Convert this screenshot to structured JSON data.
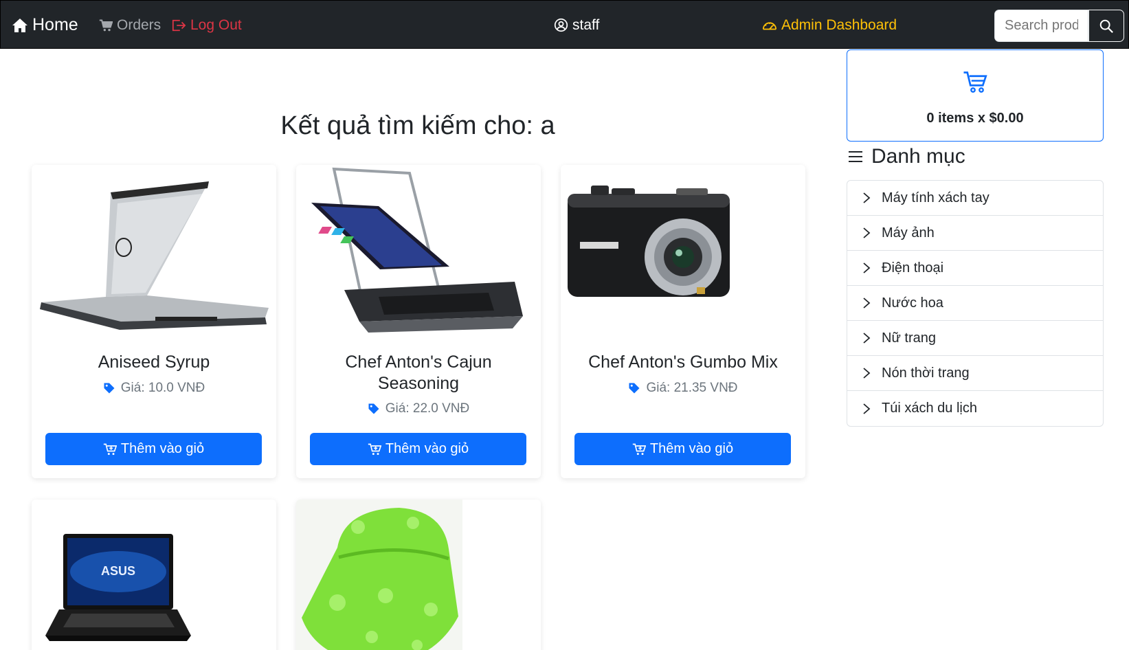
{
  "navbar": {
    "home_label": "Home",
    "orders_label": "Orders",
    "logout_label": "Log Out",
    "user_label": "staff",
    "admin_label": "Admin Dashboard",
    "search_placeholder": "Search prod",
    "colors": {
      "background": "#212529",
      "logout": "#dc3545",
      "admin": "#ffc107",
      "muted": "#a4a8ad"
    }
  },
  "main": {
    "title": "Kết quả tìm kiếm cho: a",
    "products": [
      {
        "name": "Aniseed Syrup",
        "price": "Giá: 10.0 VNĐ",
        "button_label": "Thêm vào giỏ",
        "image": "laptop-silver"
      },
      {
        "name": "Chef Anton's Cajun Seasoning",
        "price": "Giá: 22.0 VNĐ",
        "button_label": "Thêm vào giỏ",
        "image": "convertible-laptop"
      },
      {
        "name": "Chef Anton's Gumbo Mix",
        "price": "Giá: 21.35 VNĐ",
        "button_label": "Thêm vào giỏ",
        "image": "compact-camera"
      },
      {
        "image": "laptop-black"
      },
      {
        "image": "green-bucket-hat"
      }
    ]
  },
  "sidebar": {
    "cart_summary": "0 items x $0.00",
    "categories_heading": "Danh mục",
    "categories": [
      "Máy tính xách tay",
      "Máy ảnh",
      "Điện thoại",
      "Nước hoa",
      "Nữ trang",
      "Nón thời trang",
      "Túi xách du lịch"
    ]
  },
  "icons": [
    "house-icon",
    "cart-icon",
    "logout-icon",
    "user-circle-icon",
    "speedometer-icon",
    "search-icon",
    "tag-icon",
    "cart-plus-icon",
    "list-icon",
    "chevron-right-icon"
  ],
  "colors": {
    "primary": "#0d6efd",
    "text": "#212529",
    "muted": "#6c757d",
    "border": "#dee2e6"
  }
}
